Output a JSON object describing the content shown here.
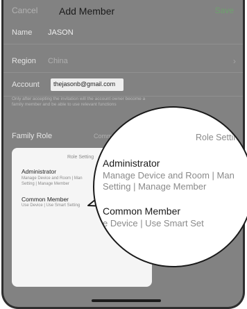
{
  "navbar": {
    "cancel": "Cancel",
    "title": "Add Member",
    "save": "Save"
  },
  "form": {
    "name_label": "Name",
    "name_value": "JASON",
    "region_label": "Region",
    "region_value": "China",
    "account_label": "Account",
    "account_value": "thejasonb@gmail.com",
    "note": "Only after accepting the invitation will the account owner become a family member and be able to use relevant functions",
    "family_role_label": "Family Role",
    "family_role_value": "Comm"
  },
  "role_sheet": {
    "title": "Role Setting",
    "options": [
      {
        "title": "Administrator",
        "desc_line1": "Manage Device and Room | Man",
        "desc_line2": "Setting | Manage Member"
      },
      {
        "title": "Common Member",
        "desc_line1": "Use Device | Use Smart Setting"
      }
    ]
  },
  "magnifier": {
    "title": "Role Setting",
    "admin_title": "Administrator",
    "admin_desc_line1": "Manage Device and Room | Man",
    "admin_desc_line2": "Setting | Manage Member",
    "common_title": "Common Member",
    "common_desc": "e Device | Use Smart Set"
  },
  "icons": {
    "region_chevron": "chevron-right-icon"
  }
}
